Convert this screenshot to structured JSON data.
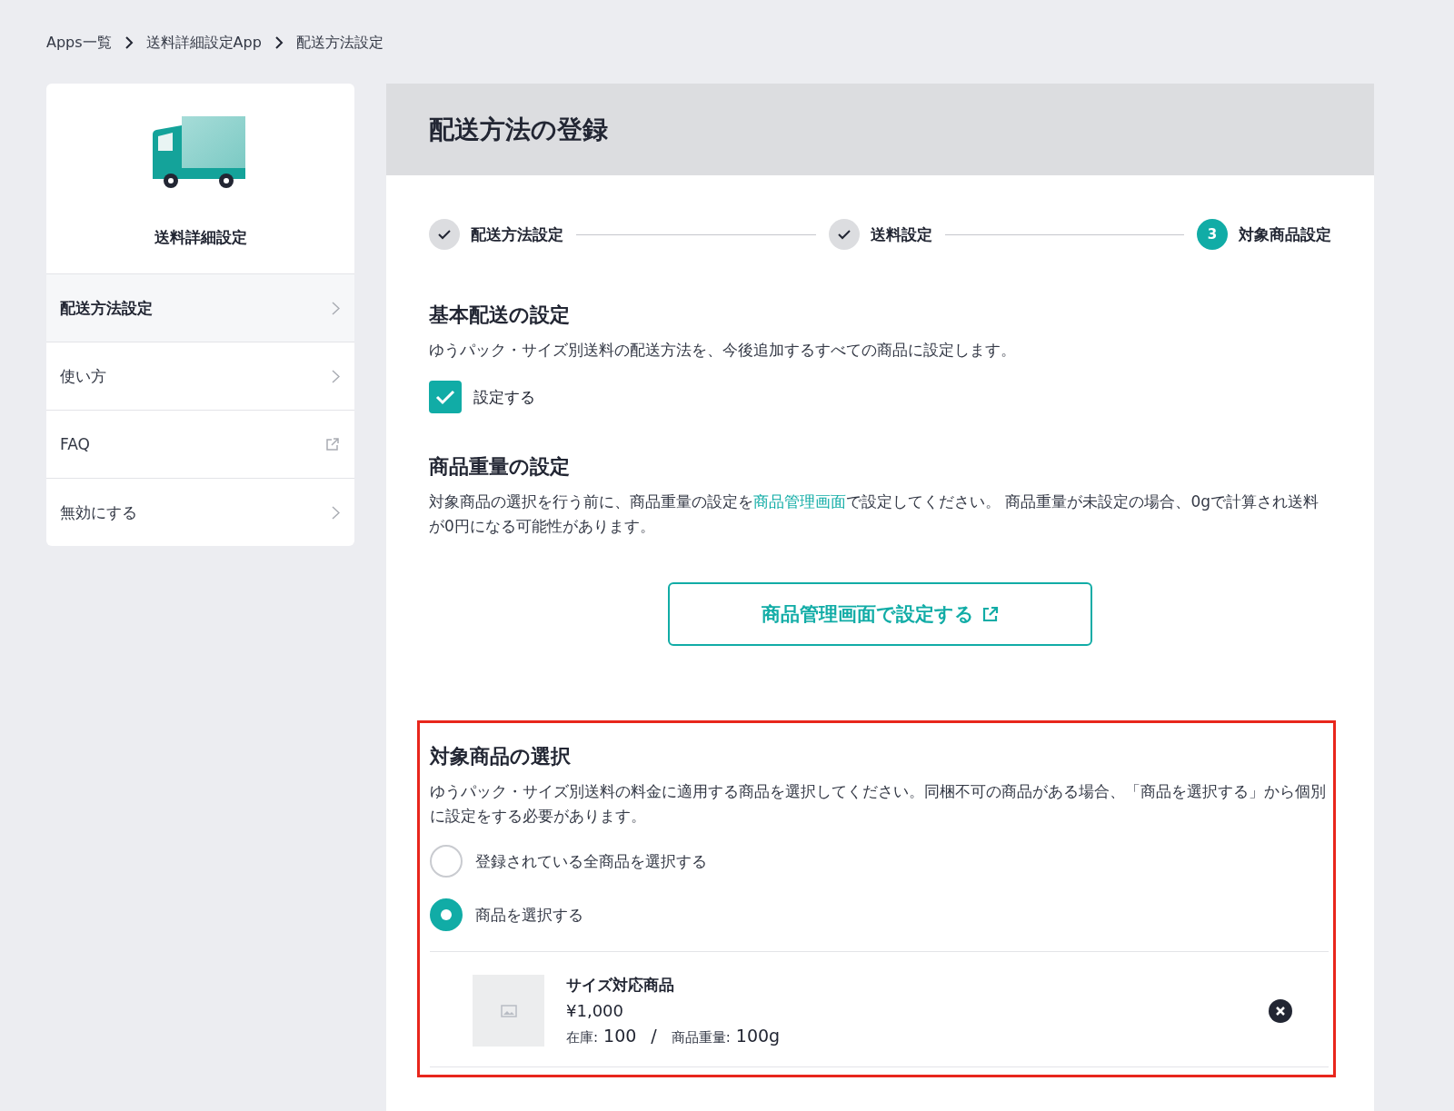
{
  "breadcrumb": [
    "Apps一覧",
    "送料詳細設定App",
    "配送方法設定"
  ],
  "sidebar": {
    "title": "送料詳細設定",
    "items": [
      {
        "label": "配送方法設定",
        "selected": true,
        "kind": "page"
      },
      {
        "label": "使い方",
        "selected": false,
        "kind": "page"
      },
      {
        "label": "FAQ",
        "selected": false,
        "kind": "external"
      },
      {
        "label": "無効にする",
        "selected": false,
        "kind": "page"
      }
    ]
  },
  "panel": {
    "title": "配送方法の登録",
    "steps": [
      {
        "label": "配送方法設定",
        "kind": "done"
      },
      {
        "label": "送料設定",
        "kind": "done"
      },
      {
        "label": "対象商品設定",
        "kind": "current",
        "number": "3"
      }
    ],
    "basic": {
      "heading": "基本配送の設定",
      "description": "ゆうパック・サイズ別送料の配送方法を、今後追加するすべての商品に設定します。",
      "checkbox": {
        "label": "設定する",
        "checked": true
      }
    },
    "weight": {
      "heading": "商品重量の設定",
      "description_before": "対象商品の選択を行う前に、商品重量の設定を",
      "link": "商品管理画面",
      "description_after": "で設定してください。 商品重量が未設定の場合、0gで計算され送料が0円になる可能性があります。",
      "button": "商品管理画面で設定する"
    },
    "selection": {
      "highlighted": true,
      "heading": "対象商品の選択",
      "description": "ゆうパック・サイズ別送料の料金に適用する商品を選択してください。同梱不可の商品がある場合、「商品を選択する」から個別に設定をする必要があります。",
      "options": [
        {
          "label": "登録されている全商品を選択する",
          "selected": false
        },
        {
          "label": "商品を選択する",
          "selected": true
        }
      ],
      "products": [
        {
          "name": "サイズ対応商品",
          "price": "¥1,000",
          "stock_label": "在庫:",
          "stock": "100",
          "separator": "/",
          "weight_label": "商品重量:",
          "weight": "100g"
        }
      ]
    }
  }
}
